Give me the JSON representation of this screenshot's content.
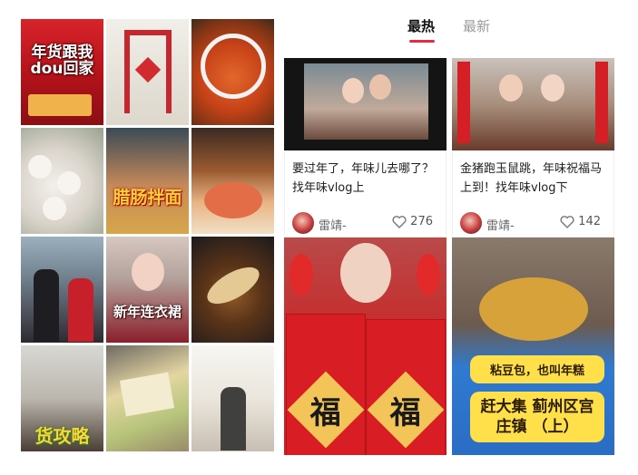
{
  "tabs": {
    "hot": "最热",
    "new": "最新"
  },
  "left_grid": {
    "tile1_caption": "年货跟我 dou回家",
    "tile5_caption": "腊肠拌面",
    "tile8_caption": "新年连衣裙",
    "tile10_caption": "货攻略"
  },
  "cards": [
    {
      "title": "要过年了，年味儿去哪了？找年味vlog上",
      "author": "雷靖-",
      "likes": "276"
    },
    {
      "title": "金猪跑玉鼠跳，年味祝福马上到！找年味vlog下",
      "author": "雷靖-",
      "likes": "142"
    }
  ],
  "big_cards": {
    "a_fu_left": "福",
    "a_fu_right": "福",
    "b_caption_top": "粘豆包，也叫年糕",
    "b_caption_main": "赶大集 蓟州区宫庄镇 （上）"
  },
  "colors": {
    "accent": "#ee2a43"
  }
}
